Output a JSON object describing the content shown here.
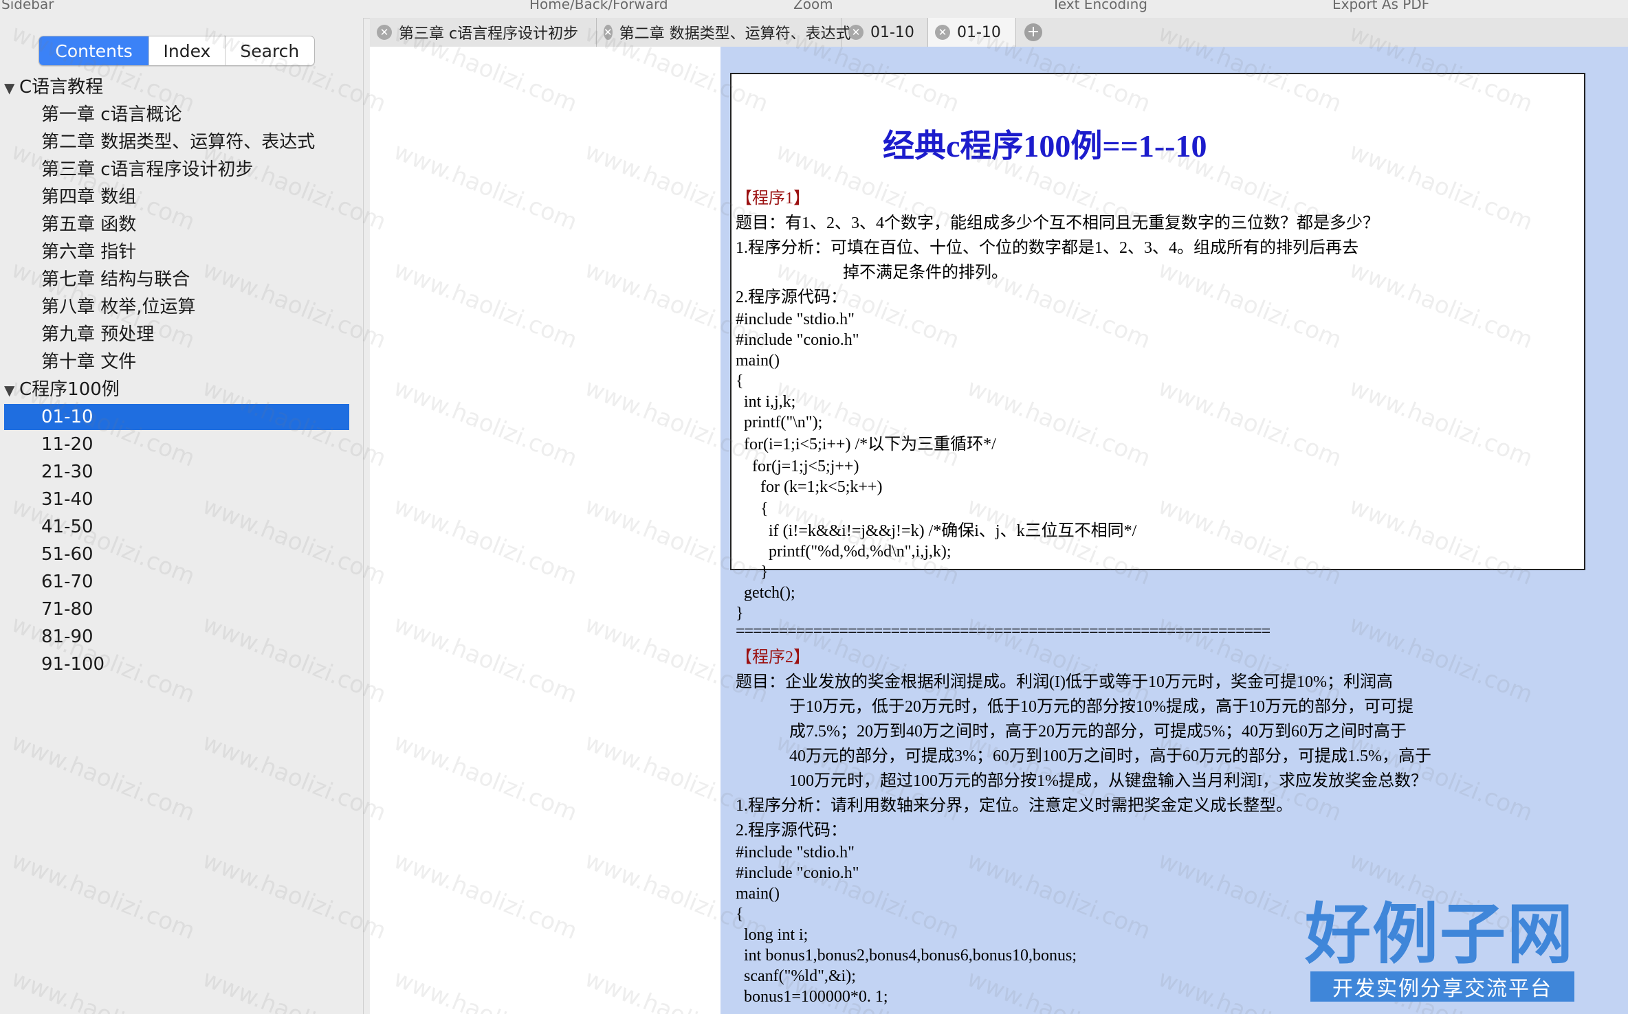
{
  "toolbar": {
    "sidebar": "Sidebar",
    "home_back_forward": "Home/Back/Forward",
    "zoom": "Zoom",
    "text_encoding": "Text Encoding",
    "export_pdf": "Export As PDF"
  },
  "sidebar": {
    "segments": [
      "Contents",
      "Index",
      "Search"
    ],
    "active_segment": "Contents",
    "groups": [
      {
        "label": "C语言教程",
        "items": [
          "第一章 c语言概论",
          "第二章 数据类型、运算符、表达式",
          "第三章 c语言程序设计初步",
          "第四章 数组",
          "第五章 函数",
          "第六章 指针",
          "第七章 结构与联合",
          "第八章 枚举,位运算",
          "第九章 预处理",
          "第十章 文件"
        ]
      },
      {
        "label": "C程序100例",
        "items": [
          "01-10",
          "11-20",
          "21-30",
          "31-40",
          "41-50",
          "51-60",
          "61-70",
          "71-80",
          "81-90",
          "91-100"
        ]
      }
    ],
    "selected": "01-10"
  },
  "tabs": [
    "第三章 c语言程序设计初步",
    "第二章 数据类型、运算符、表达式",
    "01-10",
    "01-10"
  ],
  "active_tab": 3,
  "doc": {
    "title": "经典c程序100例==1--10",
    "p1": {
      "head": "【程序1】",
      "q": "题目：有1、2、3、4个数字，能组成多少个互不相同且无重复数字的三位数？都是多少？",
      "a1": "1.程序分析：可填在百位、十位、个位的数字都是1、2、3、4。组成所有的排列后再去",
      "a2": "掉不满足条件的排列。",
      "src": "2.程序源代码：",
      "code": [
        "#include \"stdio.h\"",
        "#include \"conio.h\"",
        "main()",
        "{",
        "  int i,j,k;",
        "  printf(\"\\n\");",
        "  for(i=1;i<5;i++) /*以下为三重循环*/",
        "    for(j=1;j<5;j++)",
        "      for (k=1;k<5;k++)",
        "      {",
        "        if (i!=k&&i!=j&&j!=k) /*确保i、j、k三位互不相同*/",
        "        printf(\"%d,%d,%d\\n\",i,j,k);",
        "      }",
        "  getch();",
        "}"
      ]
    },
    "separator": "==============================================================",
    "p2": {
      "head": "【程序2】",
      "q": [
        "题目：企业发放的奖金根据利润提成。利润(I)低于或等于10万元时，奖金可提10%；利润高",
        "于10万元，低于20万元时，低于10万元的部分按10%提成，高于10万元的部分，可可提",
        "成7.5%；20万到40万之间时，高于20万元的部分，可提成5%；40万到60万之间时高于",
        "40万元的部分，可提成3%；60万到100万之间时，高于60万元的部分，可提成1.5%，高于",
        "100万元时，超过100万元的部分按1%提成，从键盘输入当月利润I，求应发放奖金总数？"
      ],
      "a": "1.程序分析：请利用数轴来分界，定位。注意定义时需把奖金定义成长整型。",
      "src": "2.程序源代码：",
      "code": [
        "#include \"stdio.h\"",
        "#include \"conio.h\"",
        "main()",
        "{",
        "  long int i;",
        "  int bonus1,bonus2,bonus4,bonus6,bonus10,bonus;",
        "  scanf(\"%ld\",&i);",
        "  bonus1=100000*0. 1;"
      ]
    }
  },
  "watermark": "www.haolizi.com",
  "logo": {
    "name": "好例子网",
    "tagline": "开发实例分享交流平台"
  },
  "colors": {
    "accent": "#3b82f7",
    "selection": "#1f6ee0",
    "content_bg": "#c2d3f3",
    "title": "#1c1ccc",
    "program_head": "#9b1111",
    "logo": "#3f86d9"
  }
}
